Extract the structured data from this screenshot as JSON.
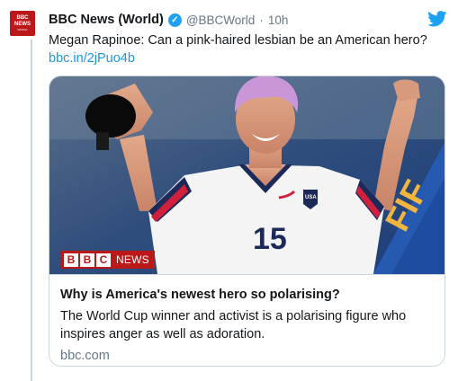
{
  "tweet": {
    "avatar_top": "BBC",
    "avatar_mid": "NEWS",
    "avatar_sub": "WORLD",
    "display_name": "BBC News (World)",
    "handle": "@BBCWorld",
    "separator": "·",
    "time": "10h",
    "text": "Megan Rapinoe: Can a pink-haired lesbian be an American hero?",
    "link": "bbc.in/2jPuo4b"
  },
  "card": {
    "brand_letters": [
      "B",
      "B",
      "C"
    ],
    "brand_news": "NEWS",
    "jersey_number": "15",
    "crest_text": "USA",
    "banner_text": "FIF",
    "title": "Why is America's newest hero so polarising?",
    "description": "The World Cup winner and activist is a polarising figure who inspires anger as well as adoration.",
    "domain": "bbc.com"
  },
  "colors": {
    "bbc_red": "#bb1919",
    "link_blue": "#1b95e0",
    "twitter_blue": "#1da1f2",
    "secondary_text": "#657786",
    "border": "#ccd6dd"
  },
  "icons": {
    "verified": "verified-badge-icon",
    "twitter": "twitter-bird-icon"
  }
}
